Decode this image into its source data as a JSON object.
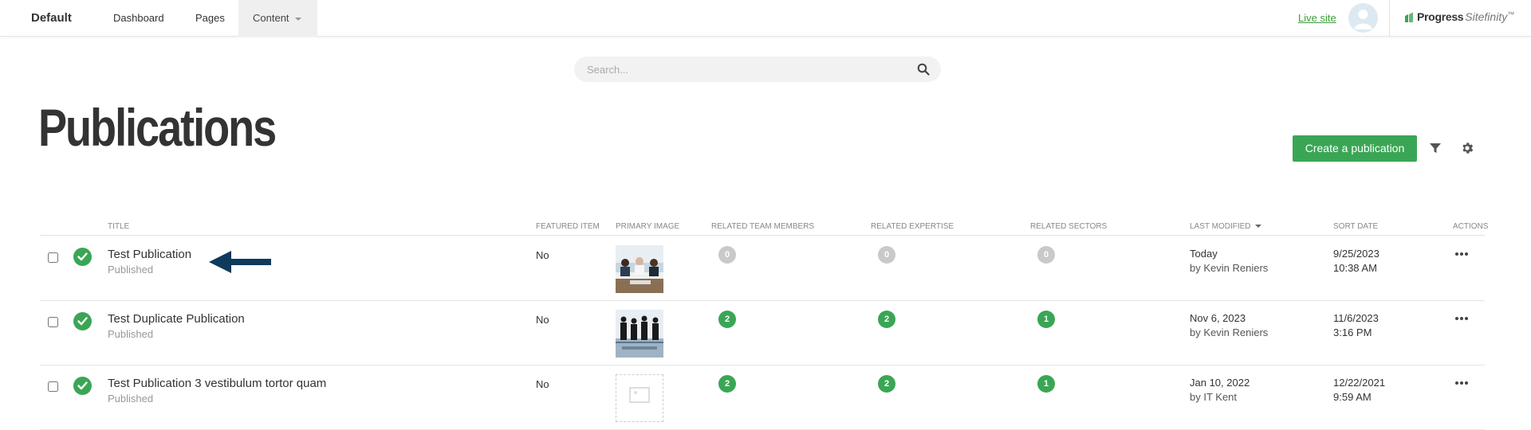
{
  "header": {
    "site_name": "Default",
    "nav": [
      {
        "label": "Dashboard"
      },
      {
        "label": "Pages"
      },
      {
        "label": "Content"
      }
    ],
    "live_site_label": "Live site",
    "brand_word1": "Progress",
    "brand_word2": "Sitefinity",
    "brand_tm": "™"
  },
  "search": {
    "placeholder": "Search..."
  },
  "page": {
    "title": "Publications",
    "create_label": "Create a publication"
  },
  "table": {
    "columns": {
      "title": "Title",
      "featured": "Featured item",
      "primary_image": "Primary image",
      "team": "Related team members",
      "expertise": "Related expertise",
      "sectors": "Related sectors",
      "last_modified": "Last modified",
      "sort_date": "Sort date",
      "actions": "Actions"
    },
    "rows": [
      {
        "title": "Test Publication",
        "status": "Published",
        "featured": "No",
        "team": "0",
        "expertise": "0",
        "sectors": "0",
        "modified_line1": "Today",
        "modified_line2": "by Kevin Reniers",
        "sort_date": "9/25/2023",
        "sort_time": "10:38 AM"
      },
      {
        "title": "Test Duplicate Publication",
        "status": "Published",
        "featured": "No",
        "team": "2",
        "expertise": "2",
        "sectors": "1",
        "modified_line1": "Nov 6, 2023",
        "modified_line2": "by Kevin Reniers",
        "sort_date": "11/6/2023",
        "sort_time": "3:16 PM"
      },
      {
        "title": "Test Publication 3 vestibulum tortor quam",
        "status": "Published",
        "featured": "No",
        "team": "2",
        "expertise": "2",
        "sectors": "1",
        "modified_line1": "Jan 10, 2022",
        "modified_line2": "by IT Kent",
        "sort_date": "12/22/2021",
        "sort_time": "9:59 AM"
      }
    ]
  },
  "colors": {
    "accent_green": "#3aa655",
    "arrow_navy": "#0f3a5c",
    "badge_zero": "#c9c9c9"
  }
}
